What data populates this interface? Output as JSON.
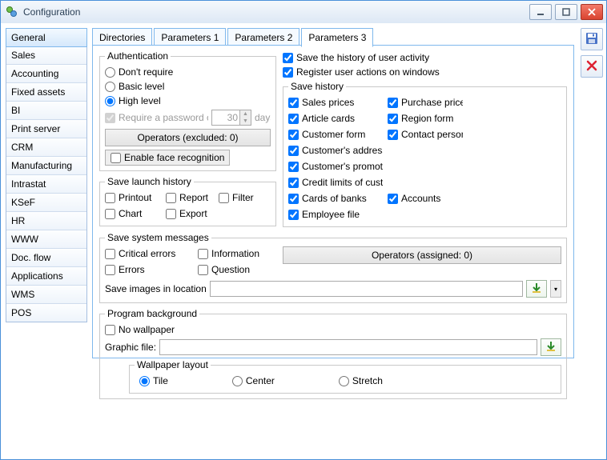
{
  "window": {
    "title": "Configuration"
  },
  "sidebar": {
    "items": [
      "General",
      "Sales",
      "Accounting",
      "Fixed assets",
      "BI",
      "Print server",
      "CRM",
      "Manufacturing",
      "Intrastat",
      "KSeF",
      "HR",
      "WWW",
      "Doc. flow",
      "Applications",
      "WMS",
      "POS"
    ],
    "selected": 0
  },
  "tabs": {
    "items": [
      "Directories",
      "Parameters 1",
      "Parameters 2",
      "Parameters 3"
    ],
    "active": 3
  },
  "auth": {
    "legend": "Authentication",
    "dont_require": "Don't require",
    "basic_level": "Basic level",
    "high_level": "High level",
    "selected": "high",
    "pwd_change_label": "Require a password change every",
    "pwd_days_value": "30",
    "pwd_days_suffix": "days",
    "operators_button": "Operators (excluded: 0)",
    "face_recognition": "Enable face recognition"
  },
  "history_top": {
    "save_history_user_activity": "Save the history of user activity",
    "register_user_actions": "Register user actions on windows"
  },
  "save_history_group": {
    "legend": "Save history",
    "items_left": [
      "Sales prices",
      "Article cards",
      "Customer form",
      "Customer's addresses",
      "Customer's promotions",
      "Credit limits of customer's card",
      "Cards of banks",
      "Employee file"
    ],
    "items_right": [
      "Purchase price",
      "Region form",
      "Contact persons",
      "",
      "",
      "",
      "Accounts",
      ""
    ]
  },
  "launch_history": {
    "legend": "Save launch history",
    "items": [
      "Printout",
      "Report",
      "Filter",
      "Chart",
      "Export"
    ]
  },
  "system_messages": {
    "legend": "Save system messages",
    "items": [
      "Critical errors",
      "Information",
      "Errors",
      "Question"
    ],
    "operators_button": "Operators (assigned: 0)",
    "images_label": "Save images in location"
  },
  "background": {
    "legend": "Program background",
    "no_wallpaper": "No wallpaper",
    "graphic_file_label": "Graphic file:",
    "layout_legend": "Wallpaper layout",
    "tile": "Tile",
    "center": "Center",
    "stretch": "Stretch",
    "selected": "tile"
  }
}
